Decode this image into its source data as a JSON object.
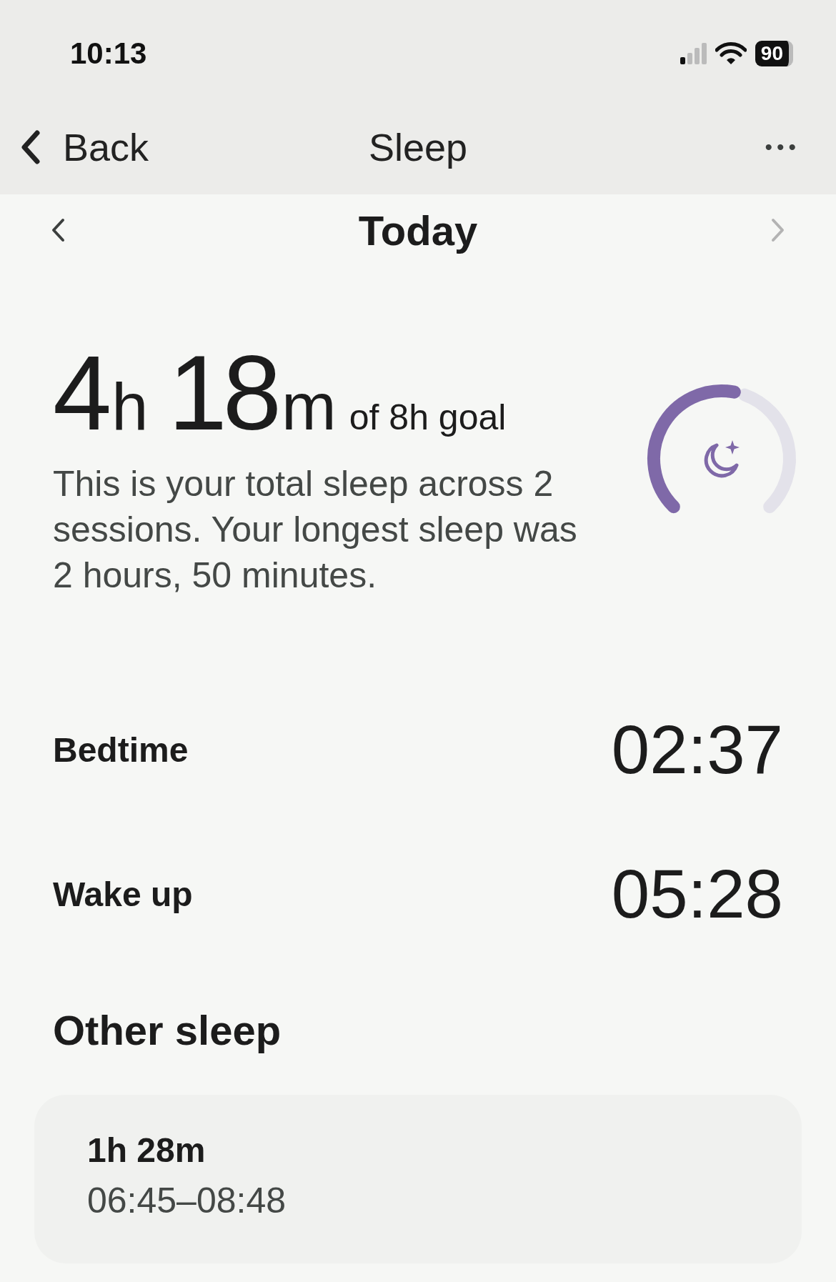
{
  "status_bar": {
    "time": "10:13",
    "battery": "90"
  },
  "nav_bar": {
    "back": "Back",
    "title": "Sleep",
    "more": "•••"
  },
  "date_nav": {
    "label": "Today",
    "previous_enabled": true,
    "next_enabled": false
  },
  "summary": {
    "hours": "4",
    "hours_unit": "h",
    "minutes": "18",
    "minutes_unit": "m",
    "goal": "of 8h goal",
    "description": "This is your total sleep across 2 sessions. Your longest sleep was 2 hours, 50 minutes."
  },
  "times": [
    {
      "label": "Bedtime",
      "value": "02:37"
    },
    {
      "label": "Wake up",
      "value": "05:28"
    }
  ],
  "other_sleep": {
    "heading": "Other sleep",
    "sessions": [
      {
        "duration": "1h 28m",
        "range": "06:45–08:48"
      }
    ]
  }
}
